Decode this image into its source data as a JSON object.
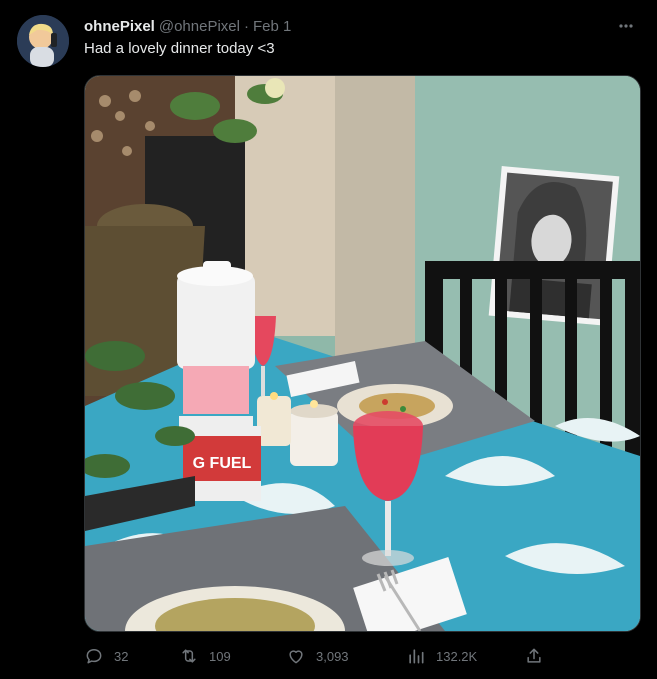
{
  "tweet": {
    "display_name": "ohnePixel",
    "handle": "@ohnePixel",
    "separator": "·",
    "date": "Feb 1",
    "text": "Had a lovely dinner today <3",
    "media_label": "G FUEL"
  },
  "metrics": {
    "replies": "32",
    "retweets": "109",
    "likes": "3,093",
    "views": "132.2K"
  },
  "icons": {
    "more": "more-icon",
    "reply": "reply-icon",
    "retweet": "retweet-icon",
    "like": "heart-icon",
    "views": "views-icon",
    "share": "share-icon"
  },
  "colors": {
    "background": "#000000",
    "text_primary": "#e7e9ea",
    "text_secondary": "#71767b",
    "border": "#2f3336"
  }
}
